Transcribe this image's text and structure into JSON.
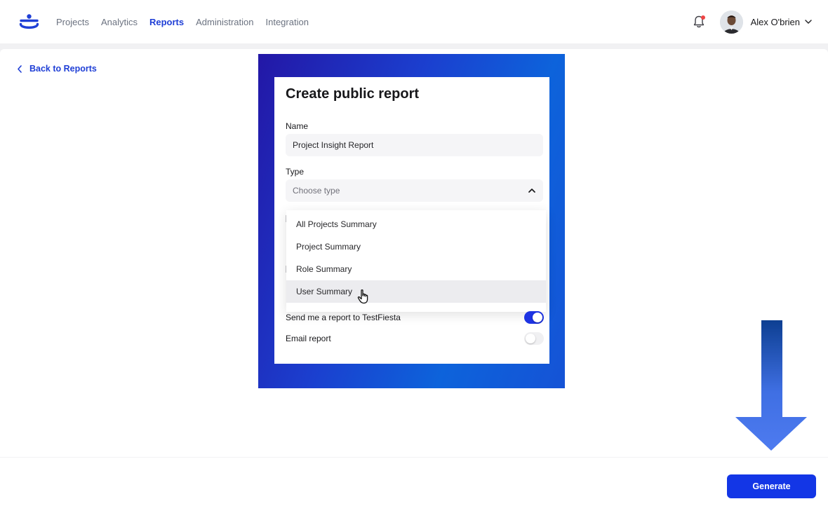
{
  "nav": {
    "items": [
      {
        "label": "Projects",
        "active": false
      },
      {
        "label": "Analytics",
        "active": false
      },
      {
        "label": "Reports",
        "active": true
      },
      {
        "label": "Administration",
        "active": false
      },
      {
        "label": "Integration",
        "active": false
      }
    ],
    "user_name": "Alex O'brien",
    "icons": [
      "logo",
      "bell-icon",
      "avatar",
      "chevron-down-icon"
    ]
  },
  "back_link": {
    "label": "Back to Reports"
  },
  "form": {
    "title": "Create public report",
    "name_label": "Name",
    "name_value": "Project Insight Report",
    "type_label": "Type",
    "type_placeholder": "Choose type",
    "type_options": [
      "All Projects Summary",
      "Project Summary",
      "Role Summary",
      "User Summary"
    ],
    "highlighted_option": "User Summary",
    "toggles": [
      {
        "label": "Send me a report to TestFiesta",
        "on": true
      },
      {
        "label": "Email report",
        "on": false
      }
    ]
  },
  "footer": {
    "generate_label": "Generate"
  },
  "colors": {
    "accent": "#1336e6",
    "nav_active": "#1f3fd6",
    "gradient_start": "#2317a6",
    "gradient_end": "#0d63db",
    "arrow": "#4b73ea"
  }
}
